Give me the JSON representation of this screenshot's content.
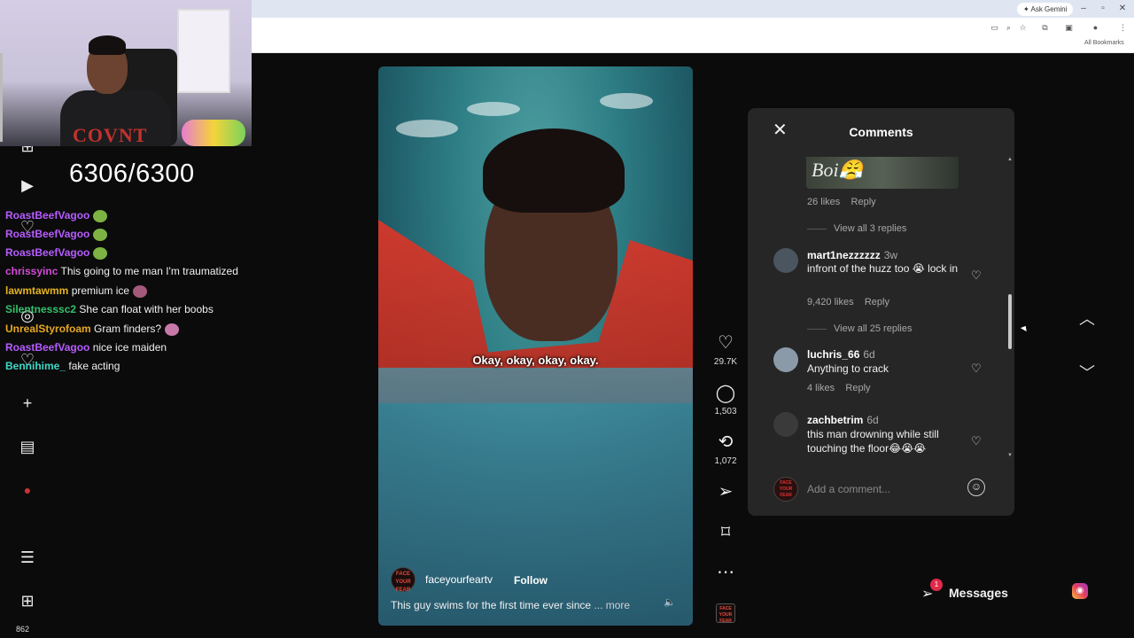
{
  "browser": {
    "ask_gemini": "Ask Gemini",
    "all_bookmarks": "All Bookmarks"
  },
  "overlay": {
    "counter": "6306/6300",
    "follower_count": "862"
  },
  "chat": [
    {
      "user": "RoastBeefVagoo",
      "message": "",
      "user_color": "#b65cff"
    },
    {
      "user": "RoastBeefVagoo",
      "message": "",
      "user_color": "#b65cff"
    },
    {
      "user": "RoastBeefVagoo",
      "message": "",
      "user_color": "#b65cff"
    },
    {
      "user": "chrissyinc",
      "message": "This going to me man I'm traumatized",
      "user_color": "#d24bd6"
    },
    {
      "user": "lawmtawmm",
      "message": "premium ice",
      "user_color": "#e6b422"
    },
    {
      "user": "Silentnesssc2",
      "message": "She can float with her boobs",
      "user_color": "#33c16c"
    },
    {
      "user": "UnrealStyrofoam",
      "message": "Gram finders?",
      "user_color": "#e6a822"
    },
    {
      "user": "RoastBeefVagoo",
      "message": "nice ice maiden",
      "user_color": "#b65cff"
    },
    {
      "user": "Bennihime_",
      "message": "fake acting",
      "user_color": "#3fd8c6"
    }
  ],
  "video": {
    "subtitle": "Okay, okay, okay, okay.",
    "username": "faceyourfeartv",
    "follow_label": "Follow",
    "caption": "This guy swims for the first time ever since",
    "more_label": "... more",
    "avatar_text": "FACE YOUR FEAR"
  },
  "actions": {
    "likes": "29.7K",
    "comments": "1,503",
    "reposts": "1,072"
  },
  "comments": {
    "title": "Comments",
    "top_image_text": "Boi😤",
    "top_meta_likes": "26 likes",
    "top_meta_reply": "Reply",
    "view_replies_1": "View all 3 replies",
    "view_replies_2": "View all 25 replies",
    "items": [
      {
        "user": "mart1nezzzzzz",
        "time": "3w",
        "text": "infront of the huzz too 😭 lock in",
        "likes": "9,420 likes",
        "reply": "Reply"
      },
      {
        "user": "luchris_66",
        "time": "6d",
        "text": "Anything to crack",
        "likes": "4 likes",
        "reply": "Reply"
      },
      {
        "user": "zachbetrim",
        "time": "6d",
        "text": "this man drowning while still touching the floor😂😭😭",
        "likes": "",
        "reply": ""
      }
    ],
    "input_placeholder": "Add a comment..."
  },
  "messages": {
    "label": "Messages",
    "badge": "1"
  },
  "colors": {
    "page_bg": "#0b0b0b",
    "panel_bg": "#262626",
    "badge_red": "#e02a4a"
  }
}
